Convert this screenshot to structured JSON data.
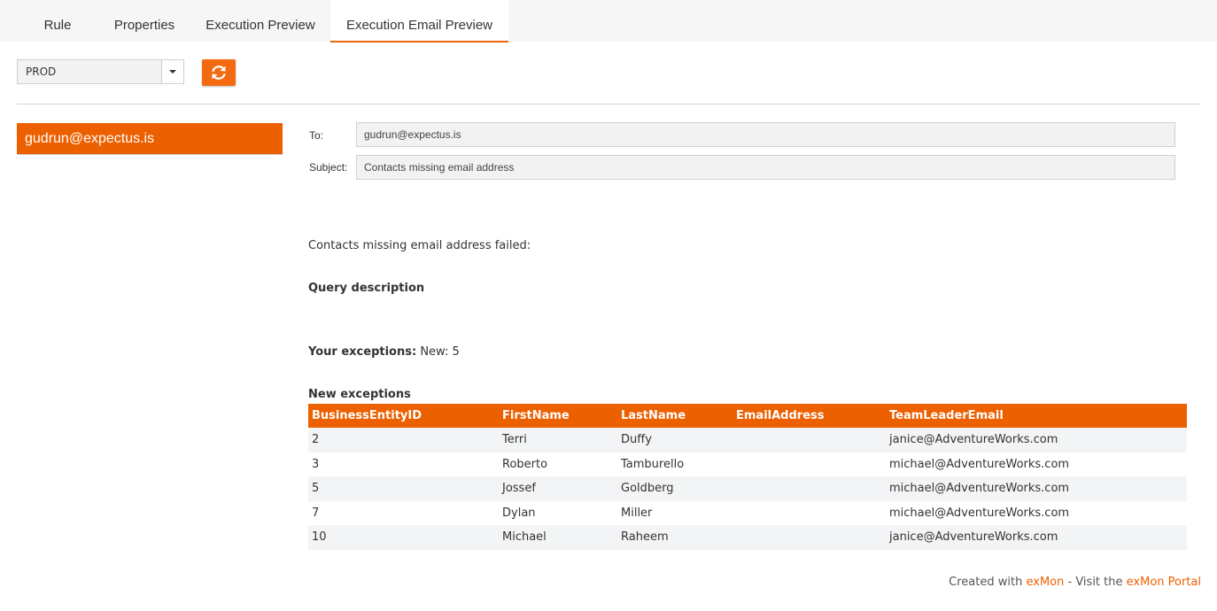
{
  "tabs": [
    {
      "label": "Rule",
      "active": false
    },
    {
      "label": "Properties",
      "active": false
    },
    {
      "label": "Execution Preview",
      "active": false
    },
    {
      "label": "Execution Email Preview",
      "active": true
    }
  ],
  "toolbar": {
    "environment": "PROD",
    "refresh_icon": "refresh-icon",
    "accent_color": "#ed6000"
  },
  "recipients": [
    "gudrun@expectus.is"
  ],
  "email": {
    "to_label": "To:",
    "to_value": "gudrun@expectus.is",
    "subject_label": "Subject:",
    "subject_value": "Contacts missing email address",
    "intro": "Contacts missing email address failed:",
    "query_heading": "Query description",
    "exceptions_label": "Your exceptions:",
    "exceptions_value": "New: 5",
    "new_exceptions_heading": "New exceptions"
  },
  "table": {
    "columns": [
      "BusinessEntityID",
      "FirstName",
      "LastName",
      "EmailAddress",
      "TeamLeaderEmail"
    ],
    "rows": [
      [
        "2",
        "Terri",
        "Duffy",
        "",
        "janice@AdventureWorks.com"
      ],
      [
        "3",
        "Roberto",
        "Tamburello",
        "",
        "michael@AdventureWorks.com"
      ],
      [
        "5",
        "Jossef",
        "Goldberg",
        "",
        "michael@AdventureWorks.com"
      ],
      [
        "7",
        "Dylan",
        "Miller",
        "",
        "michael@AdventureWorks.com"
      ],
      [
        "10",
        "Michael",
        "Raheem",
        "",
        "janice@AdventureWorks.com"
      ]
    ]
  },
  "footer": {
    "created_with": "Created with",
    "brand": "exMon",
    "visit": "- Visit the",
    "portal": "exMon Portal"
  }
}
